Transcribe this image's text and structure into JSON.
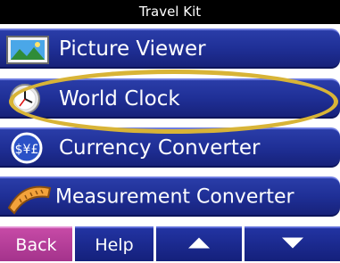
{
  "title_bar": {
    "title": "Travel Kit"
  },
  "menu": {
    "items": [
      {
        "label": "Picture Viewer",
        "icon": "picture-icon"
      },
      {
        "label": "World Clock",
        "icon": "clock-icon"
      },
      {
        "label": "Currency Converter",
        "icon": "currency-icon"
      },
      {
        "label": "Measurement Converter",
        "icon": "measuring-tape-icon"
      }
    ],
    "highlighted_item": "World Clock"
  },
  "bottom_bar": {
    "back_label": "Back",
    "help_label": "Help",
    "up_icon": "arrow-up-icon",
    "down_icon": "arrow-down-icon"
  },
  "colors": {
    "menu_blue": "#1f2f96",
    "back_button": "#b13d98",
    "highlight_ellipse": "#d8b437"
  }
}
